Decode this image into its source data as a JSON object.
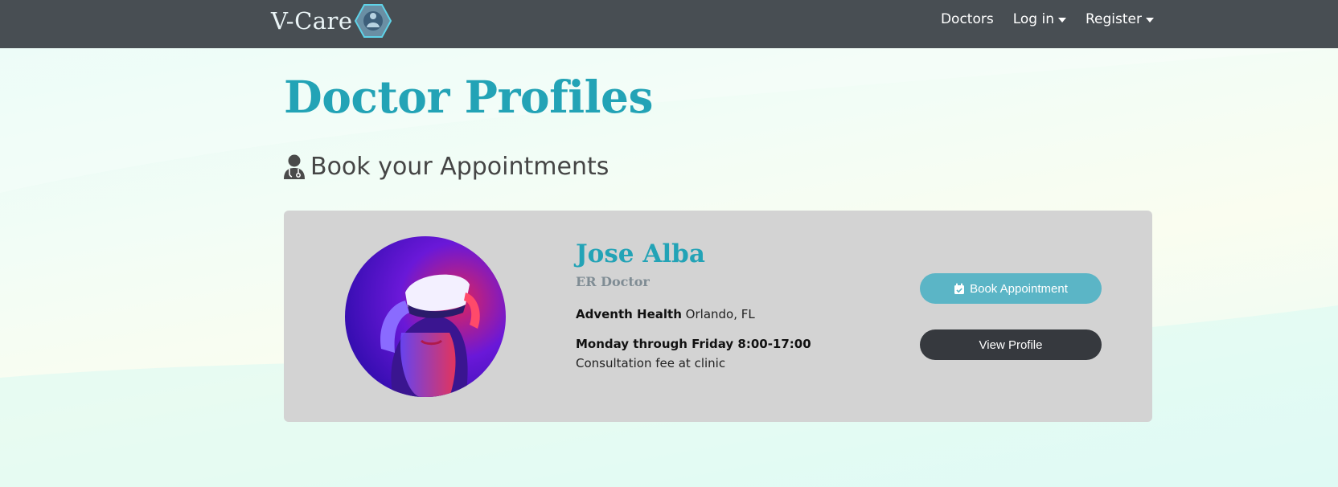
{
  "nav": {
    "brand": "V-Care",
    "links": {
      "doctors": "Doctors",
      "login": "Log in",
      "register": "Register"
    }
  },
  "page": {
    "title": "Doctor Profiles",
    "subtitle": "Book your Appointments"
  },
  "doctor": {
    "name": "Jose Alba",
    "role": "ER Doctor",
    "hospital": "Adventh Health",
    "location": "Orlando, FL",
    "schedule": "Monday through Friday 8:00-17:00",
    "fee_note": "Consultation fee at clinic"
  },
  "buttons": {
    "book": "Book Appointment",
    "view": "View Profile"
  },
  "colors": {
    "navbar": "#484e53",
    "accent": "#23a3b6",
    "book_button": "#5bb5c6",
    "view_button": "#36393e",
    "card": "#d3d3d3"
  },
  "icons": {
    "logo": "medical-hexagon-logo",
    "subtitle": "doctor-icon",
    "book": "calendar-check-icon"
  }
}
